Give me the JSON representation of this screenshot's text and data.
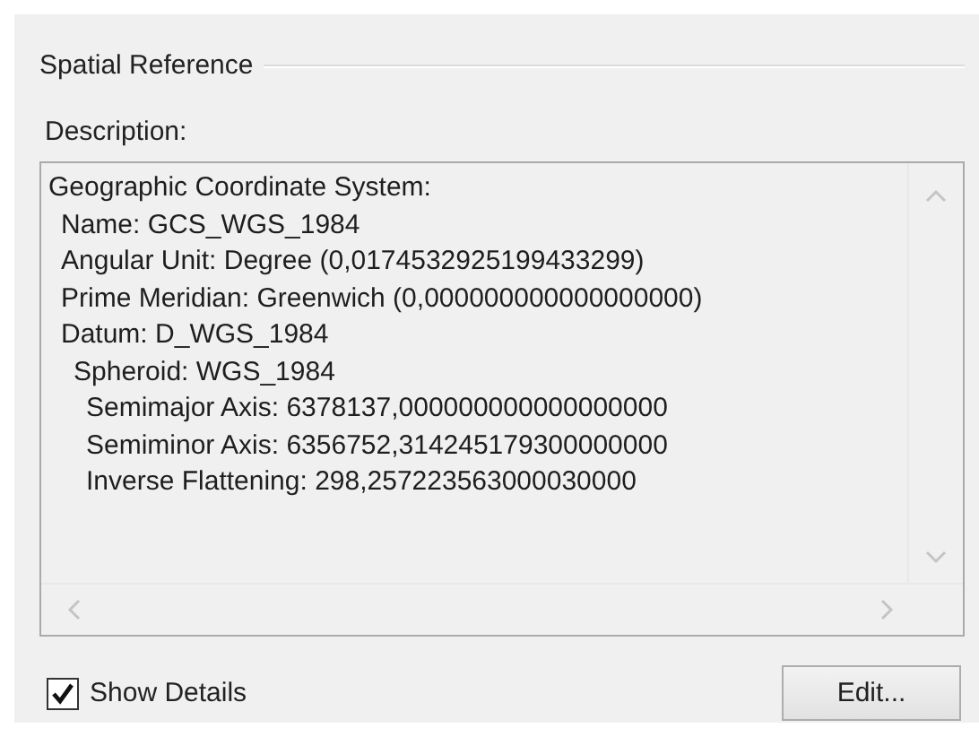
{
  "group": {
    "title": "Spatial Reference"
  },
  "description_label": "Description:",
  "description": [
    {
      "text": "Geographic Coordinate System:",
      "children": [
        {
          "text": "Name: GCS_WGS_1984"
        },
        {
          "text": "Angular Unit: Degree (0,0174532925199433299)"
        },
        {
          "text": "Prime Meridian: Greenwich (0,000000000000000000)"
        },
        {
          "text": "Datum: D_WGS_1984",
          "children": [
            {
              "text": "Spheroid: WGS_1984",
              "children": [
                {
                  "text": "Semimajor Axis: 6378137,000000000000000000"
                },
                {
                  "text": "Semiminor Axis: 6356752,314245179300000000"
                },
                {
                  "text": "Inverse Flattening: 298,257223563000030000"
                }
              ]
            }
          ]
        }
      ]
    }
  ],
  "show_details": {
    "label": "Show Details",
    "checked": true
  },
  "edit_button": "Edit..."
}
